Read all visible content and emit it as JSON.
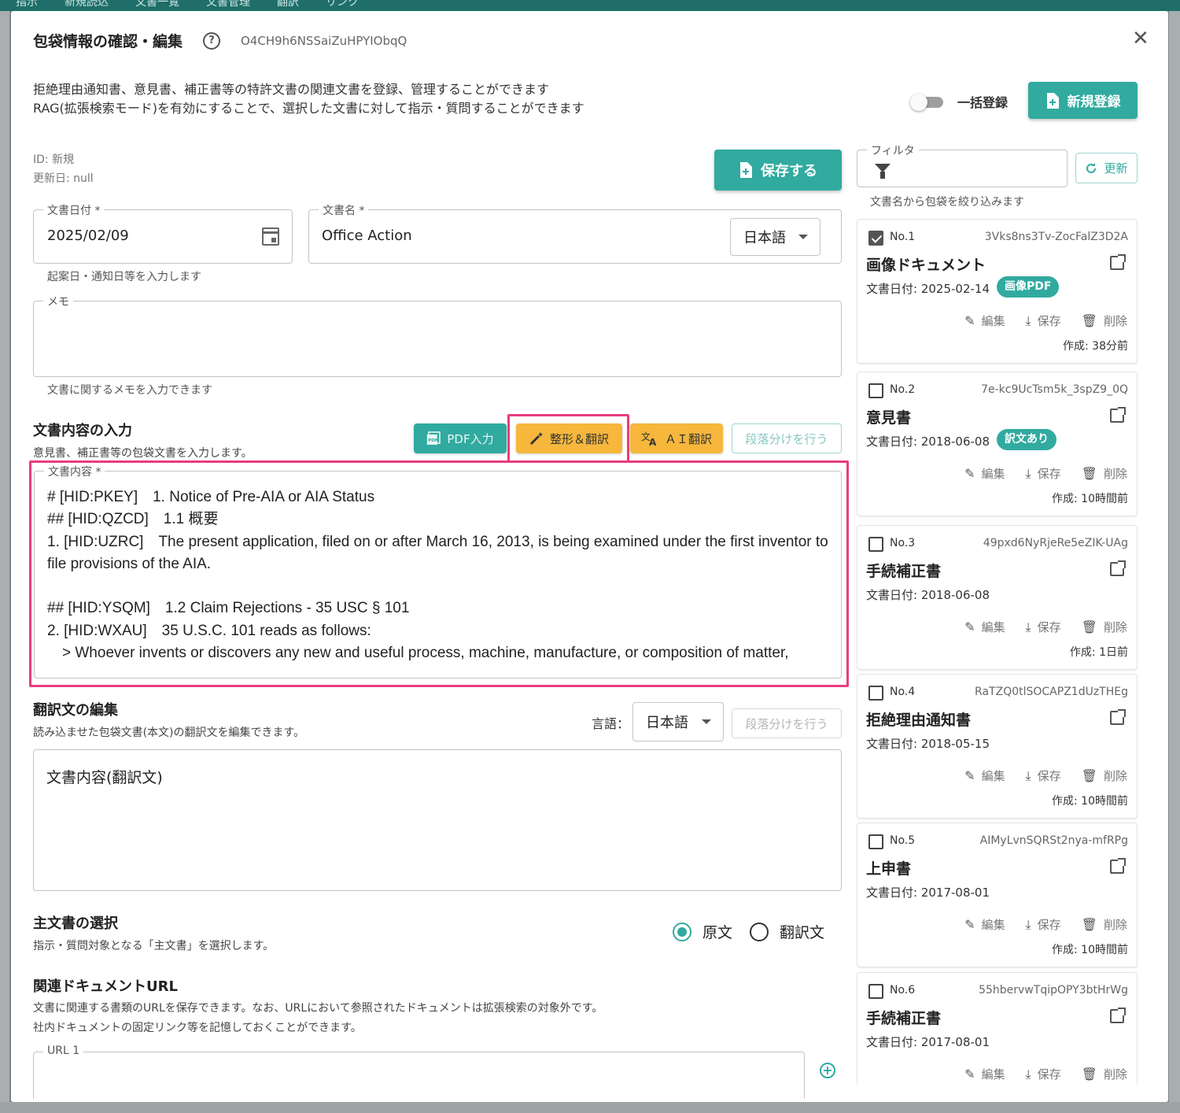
{
  "background_tabs": [
    "指示",
    "新規読込",
    "文書一覧",
    "文書管理",
    "翻訳",
    "リンク"
  ],
  "dialog": {
    "title": "包袋情報の確認・編集",
    "help_icon": "?",
    "env_id": "O4CH9h6NSSaiZuHPYIObqQ",
    "close_icon": "✕",
    "description_line1": "拒絶理由通知書、意見書、補正書等の特許文書の関連文書を登録、管理することができます",
    "description_line2": "RAG(拡張検索モード)を有効にすることで、選択した文書に対して指示・質問することができます",
    "bulk_toggle_label": "一括登録",
    "bulk_toggle_on": false,
    "new_button_label": "新規登録"
  },
  "form": {
    "id_text": "ID: 新規",
    "updated_text": "更新日: null",
    "save_button_label": "保存する",
    "date_label": "文書日付 *",
    "date_value": "2025/02/09",
    "date_helper": "起案日・通知日等を入力します",
    "name_label": "文書名 *",
    "name_value": "Office Action",
    "name_lang": "日本語",
    "memo_label": "メモ",
    "memo_value": "",
    "memo_helper": "文書に関するメモを入力できます"
  },
  "content_section": {
    "title": "文書内容の入力",
    "subtitle": "意見書、補正書等の包袋文書を入力します。",
    "pdf_button": "PDF入力",
    "format_button": "整形＆翻訳",
    "ai_button": "ＡＩ翻訳",
    "paragraph_button": "段落分けを行う",
    "content_label": "文書内容 *",
    "content_text": "# [HID:PKEY]　1. Notice of Pre-AIA or AIA Status\n## [HID:QZCD]　1.1 概要\n1. [HID:UZRC]　The present application, filed on or after March 16, 2013, is being examined under the first inventor to file provisions of the AIA.\n\n## [HID:YSQM]　1.2 Claim Rejections - 35 USC § 101\n2. [HID:WXAU]　35 U.S.C. 101 reads as follows:\n　> Whoever invents or discovers any new and useful process, machine, manufacture, or composition of matter,"
  },
  "translation_section": {
    "title": "翻訳文の編集",
    "subtitle": "読み込ませた包袋文書(本文)の翻訳文を編集できます。",
    "lang_label": "言語：",
    "lang_value": "日本語",
    "paragraph_button": "段落分けを行う",
    "placeholder": "文書内容(翻訳文)"
  },
  "main_doc_section": {
    "title": "主文書の選択",
    "subtitle": "指示・質問対象となる「主文書」を選択します。",
    "option_original": "原文",
    "option_translation": "翻訳文",
    "selected": "原文"
  },
  "url_section": {
    "title": "関連ドキュメントURL",
    "subtitle_line1": "文書に関連する書類のURLを保存できます。なお、URLにおいて参照されたドキュメントは拡張検索の対象外です。",
    "subtitle_line2": "社内ドキュメントの固定リンク等を記憶しておくことができます。",
    "url_label": "URL 1",
    "add_icon": "+"
  },
  "filter": {
    "label": "フィルタ",
    "value": "",
    "helper": "文書名から包袋を絞り込みます",
    "refresh_label": "更新"
  },
  "documents": [
    {
      "no": "No.1",
      "id": "3Vks8ns3Tv-ZocFalZ3D2A",
      "name": "画像ドキュメント",
      "date": "文書日付: 2025-02-14",
      "badge": "画像PDF",
      "checked": true,
      "created": "作成: 38分前"
    },
    {
      "no": "No.2",
      "id": "7e-kc9UcTsm5k_3spZ9_0Q",
      "name": "意見書",
      "date": "文書日付: 2018-06-08",
      "badge": "訳文あり",
      "checked": false,
      "created": "作成: 10時間前"
    },
    {
      "no": "No.3",
      "id": "49pxd6NyRjeRe5eZIK-UAg",
      "name": "手続補正書",
      "date": "文書日付: 2018-06-08",
      "badge": "",
      "checked": false,
      "created": "作成: 1日前"
    },
    {
      "no": "No.4",
      "id": "RaTZQ0tlSOCAPZ1dUzTHEg",
      "name": "拒絶理由通知書",
      "date": "文書日付: 2018-05-15",
      "badge": "",
      "checked": false,
      "created": "作成: 10時間前"
    },
    {
      "no": "No.5",
      "id": "AIMyLvnSQRSt2nya-mfRPg",
      "name": "上申書",
      "date": "文書日付: 2017-08-01",
      "badge": "",
      "checked": false,
      "created": "作成: 10時間前"
    },
    {
      "no": "No.6",
      "id": "55hbervwTqipOPY3btHrWg",
      "name": "手続補正書",
      "date": "文書日付: 2017-08-01",
      "badge": "",
      "checked": false,
      "created": ""
    }
  ],
  "card_actions": {
    "edit": "編集",
    "save": "保存",
    "delete": "削除"
  },
  "colors": {
    "accent": "#31aaa0",
    "warning": "#f6b73c",
    "highlight": "#e83c80"
  }
}
